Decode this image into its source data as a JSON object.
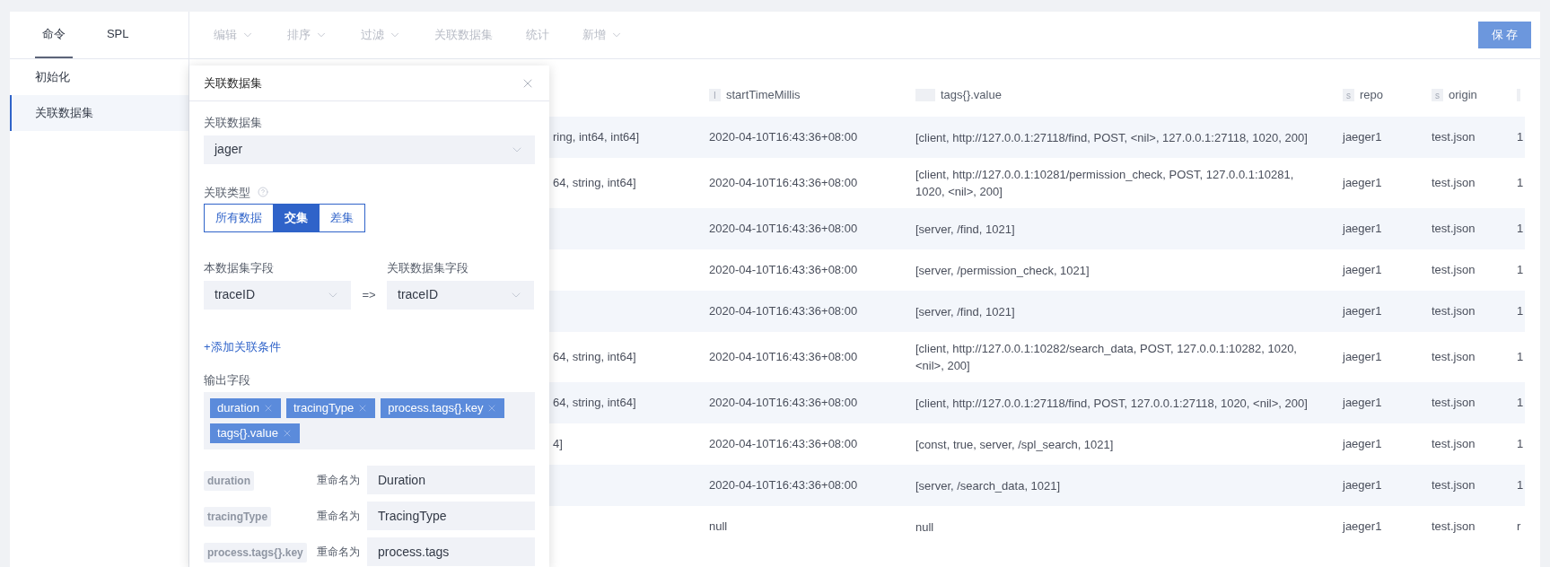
{
  "sidebar": {
    "tabs": [
      {
        "label": "命令",
        "selected": true
      },
      {
        "label": "SPL",
        "selected": false
      }
    ],
    "items": [
      {
        "label": "初始化",
        "selected": false
      },
      {
        "label": "关联数据集",
        "selected": true
      }
    ]
  },
  "toolbar": {
    "items": [
      {
        "label": "编辑",
        "dropdown": true,
        "disabled": true
      },
      {
        "label": "排序",
        "dropdown": true,
        "disabled": true
      },
      {
        "label": "过滤",
        "dropdown": true,
        "disabled": true
      },
      {
        "label": "关联数据集",
        "dropdown": false,
        "disabled": true
      },
      {
        "label": "统计",
        "dropdown": false,
        "disabled": true
      },
      {
        "label": "新增",
        "dropdown": true,
        "disabled": true
      }
    ],
    "save_button": "保 存"
  },
  "dialog": {
    "title": "关联数据集",
    "dataset_label": "关联数据集",
    "dataset_value": "jager",
    "join_type_label": "关联类型",
    "join_types": [
      {
        "label": "所有数据",
        "selected": false
      },
      {
        "label": "交集",
        "selected": true
      },
      {
        "label": "差集",
        "selected": false
      }
    ],
    "left_field_label": "本数据集字段",
    "left_field_value": "traceID",
    "mapping_arrow": "=>",
    "right_field_label": "关联数据集字段",
    "right_field_value": "traceID",
    "add_condition_link": "+添加关联条件",
    "output_label": "输出字段",
    "output_fields": [
      {
        "label": "duration"
      },
      {
        "label": "tracingType"
      },
      {
        "label": "process.tags{}.key"
      },
      {
        "label": "tags{}.value"
      }
    ],
    "renames": [
      {
        "field": "duration",
        "label": "重命名为",
        "value": "Duration"
      },
      {
        "field": "tracingType",
        "label": "重命名为",
        "value": "TracingType"
      },
      {
        "field": "process.tags{}.key",
        "label": "重命名为",
        "value": "process.tags"
      }
    ]
  },
  "table": {
    "columns": [
      {
        "label": "startTimeMillis",
        "badge": "I"
      },
      {
        "label": "tags{}.value"
      },
      {
        "label": "repo",
        "badge": "s"
      },
      {
        "label": "origin",
        "badge": "s"
      }
    ],
    "rows": [
      {
        "column_1": "ring, int64, int64]",
        "start": "2020-04-10T16:43:36+08:00",
        "tags": "[client, http://127.0.0.1:27118/find, POST, <nil>, 127.0.0.1:27118, 1020, 200]",
        "repo": "jaeger1",
        "origin": "test.json",
        "column_6": "1"
      },
      {
        "column_1": "64, string, int64]",
        "start": "2020-04-10T16:43:36+08:00",
        "tags": "[client, http://127.0.0.1:10281/permission_check, POST, 127.0.0.1:10281, 1020, <nil>, 200]",
        "repo": "jaeger1",
        "origin": "test.json",
        "column_6": "1"
      },
      {
        "start": "2020-04-10T16:43:36+08:00",
        "tags": "[server, /find, 1021]",
        "repo": "jaeger1",
        "origin": "test.json",
        "column_6": "1"
      },
      {
        "start": "2020-04-10T16:43:36+08:00",
        "tags": "[server, /permission_check, 1021]",
        "repo": "jaeger1",
        "origin": "test.json",
        "column_6": "1"
      },
      {
        "start": "2020-04-10T16:43:36+08:00",
        "tags": "[server, /find, 1021]",
        "repo": "jaeger1",
        "origin": "test.json",
        "column_6": "1"
      },
      {
        "column_1": "64, string, int64]",
        "start": "2020-04-10T16:43:36+08:00",
        "tags": "[client, http://127.0.0.1:10282/search_data, POST, 127.0.0.1:10282, 1020, <nil>, 200]",
        "repo": "jaeger1",
        "origin": "test.json",
        "column_6": "1"
      },
      {
        "column_1": "64, string, int64]",
        "start": "2020-04-10T16:43:36+08:00",
        "tags": "[client, http://127.0.0.1:27118/find, POST, 127.0.0.1:27118, 1020, <nil>, 200]",
        "repo": "jaeger1",
        "origin": "test.json",
        "column_6": "1"
      },
      {
        "column_1": "4]",
        "start": "2020-04-10T16:43:36+08:00",
        "tags": "[const, true, server, /spl_search, 1021]",
        "repo": "jaeger1",
        "origin": "test.json",
        "column_6": "1"
      },
      {
        "start": "2020-04-10T16:43:36+08:00",
        "tags": "[server, /search_data, 1021]",
        "repo": "jaeger1",
        "origin": "test.json",
        "column_6": "1"
      },
      {
        "start": "null",
        "tags": "null",
        "repo": "jaeger1",
        "origin": "test.json",
        "column_6": "r"
      }
    ]
  }
}
